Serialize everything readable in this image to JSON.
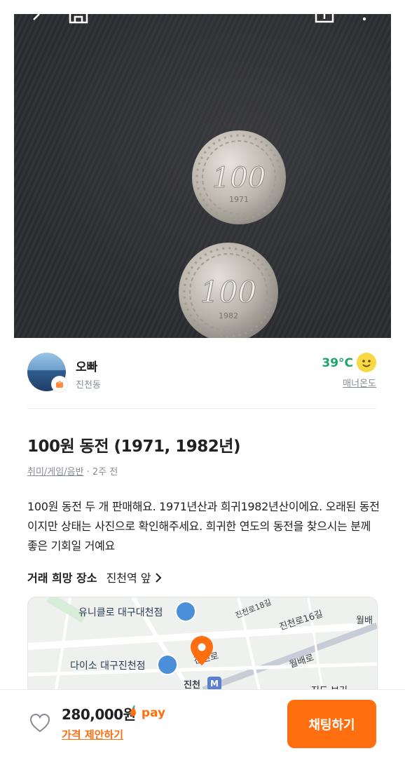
{
  "photo": {
    "coin_top": {
      "value": "100",
      "year": "1971"
    },
    "coin_bottom": {
      "value": "100",
      "year": "1982"
    }
  },
  "toolbar": {
    "icons": [
      "back-icon",
      "home-icon",
      "share-icon",
      "more-icon"
    ]
  },
  "seller": {
    "name": "오빠",
    "location": "진천동",
    "temperature": "39°C",
    "manner_label": "매너온도"
  },
  "item": {
    "title": "100원 동전 (1971, 1982년)",
    "category": "취미/게임/음반",
    "time": "· 2주 전",
    "description": "100원 동전 두 개 판매해요. 1971년산과  희귀1982년산이에요. 오래된 동전이지만 상태는 사진으로 확인해주세요. 희귀한 연도의 동전을 찾으시는 분께 좋은 기회일 거예요",
    "place_label": "거래 희망 장소",
    "place_value": "진천역 앞"
  },
  "map": {
    "labels": [
      "유니클로 대구대천점",
      "다이소 대구진천점",
      "진천로18길",
      "진천로16길",
      "월배로",
      "월배",
      "진천",
      "진천로",
      "지도 보기"
    ]
  },
  "bottom": {
    "price": "280,000원",
    "pay": "pay",
    "offer": "가격 제안하기",
    "chat_button": "채팅하기"
  },
  "colors": {
    "accent": "#ff6f0f",
    "temperature": "#1ea36a"
  }
}
